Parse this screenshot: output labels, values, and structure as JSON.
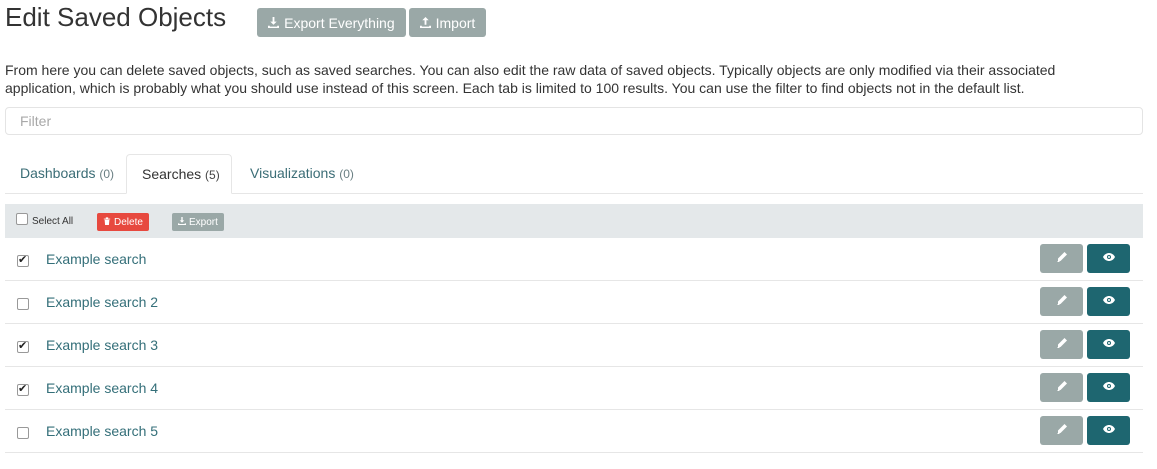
{
  "header": {
    "title": "Edit Saved Objects",
    "export_everything_label": "Export Everything",
    "import_label": "Import"
  },
  "description": "From here you can delete saved objects, such as saved searches. You can also edit the raw data of saved objects. Typically objects are only modified via their associated application, which is probably what you should use instead of this screen. Each tab is limited to 100 results. You can use the filter to find objects not in the default list.",
  "filter": {
    "placeholder": "Filter",
    "value": ""
  },
  "tabs": [
    {
      "label": "Dashboards",
      "count": "(0)",
      "active": false
    },
    {
      "label": "Searches",
      "count": "(5)",
      "active": true
    },
    {
      "label": "Visualizations",
      "count": "(0)",
      "active": false
    }
  ],
  "toolbar": {
    "select_all_label": "Select All",
    "select_all_checked": false,
    "delete_label": "Delete",
    "export_label": "Export"
  },
  "items": [
    {
      "title": "Example search",
      "checked": true
    },
    {
      "title": "Example search 2",
      "checked": false
    },
    {
      "title": "Example search 3",
      "checked": true
    },
    {
      "title": "Example search 4",
      "checked": true
    },
    {
      "title": "Example search 5",
      "checked": false
    }
  ],
  "colors": {
    "accent": "#1e6670",
    "secondary_button": "#9aa8a7",
    "danger": "#e7493f",
    "link": "#346f79"
  },
  "icons": {
    "export_everything": "download-icon",
    "import": "upload-icon",
    "delete": "trash-icon",
    "export": "download-icon",
    "edit": "pencil-icon",
    "view": "eye-icon"
  }
}
